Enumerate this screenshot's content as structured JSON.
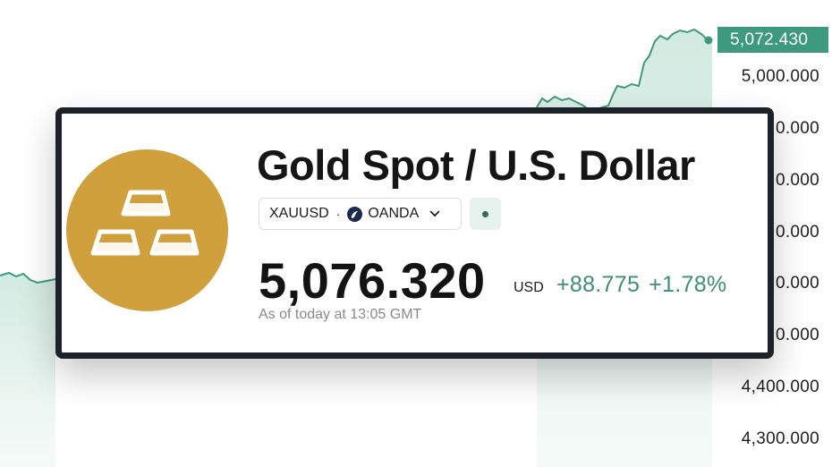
{
  "instrument": {
    "title": "Gold Spot / U.S. Dollar",
    "symbol": "XAUUSD",
    "separator": "·",
    "exchange": "OANDA",
    "price": "5,076.320",
    "currency": "USD",
    "change_abs": "+88.775",
    "change_pct": "+1.78%",
    "as_of": "As of today at 13:05 GMT"
  },
  "price_axis": {
    "current_price_tag": "5,072.430",
    "labels": [
      "5,000.000",
      "0.000",
      "0.000",
      "0.000",
      "0.000",
      "0.000",
      "4,400.000",
      "4,300.000"
    ]
  },
  "colors": {
    "accent_green": "#3d9a7d",
    "logo_gold": "#d0a03c",
    "card_border": "#1c2229"
  },
  "icons": {
    "logo": "gold-bars-icon",
    "exchange": "oanda-logo-icon",
    "dropdown": "chevron-down-icon",
    "status": "market-status-dot"
  }
}
